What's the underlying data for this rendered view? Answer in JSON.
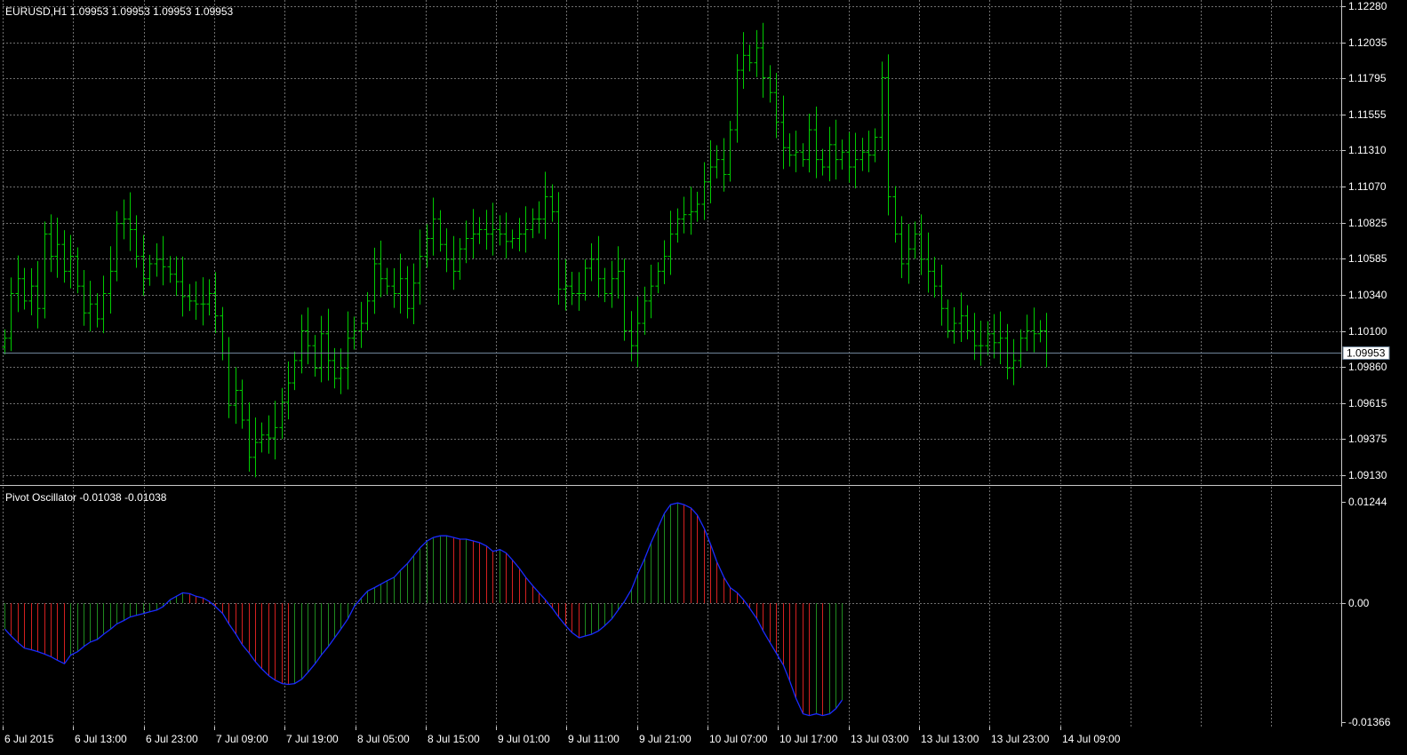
{
  "window": {
    "main_title": "EURUSD,H1  1.09953 1.09953 1.09953 1.09953",
    "indicator_title": "Pivot Oscillator -0.01038 -0.01038",
    "current_price_label": "1.09953"
  },
  "colors": {
    "background": "#000000",
    "grid": "#6f6f6f",
    "axis_text": "#ffffff",
    "bars": "#00cc00",
    "current_price_line": "#6f8499",
    "osc_line": "#1a2bff",
    "osc_up": "#1f8a1f",
    "osc_down": "#d42020"
  },
  "chart_data": [
    {
      "type": "bar",
      "symbol": "EURUSD",
      "timeframe": "H1",
      "title": "EURUSD,H1  1.09953 1.09953 1.09953 1.09953",
      "ylim": [
        1.0913,
        1.1228
      ],
      "y_ticks": [
        "1.12280",
        "1.12035",
        "1.11795",
        "1.11555",
        "1.11310",
        "1.11070",
        "1.10825",
        "1.10585",
        "1.10340",
        "1.10100",
        "1.09860",
        "1.09615",
        "1.09375",
        "1.09130"
      ],
      "current_price": 1.09953,
      "grid": true,
      "x_ticks": [
        "6 Jul 2015",
        "6 Jul 13:00",
        "6 Jul 23:00",
        "7 Jul 09:00",
        "7 Jul 19:00",
        "8 Jul 05:00",
        "8 Jul 15:00",
        "9 Jul 01:00",
        "9 Jul 11:00",
        "9 Jul 21:00",
        "10 Jul 07:00",
        "10 Jul 17:00",
        "13 Jul 03:00",
        "13 Jul 13:00",
        "13 Jul 23:00",
        "14 Jul 09:00"
      ],
      "closes": [
        1.1005,
        1.1035,
        1.1045,
        1.103,
        1.104,
        1.1025,
        1.1075,
        1.106,
        1.1068,
        1.105,
        1.106,
        1.104,
        1.1022,
        1.1028,
        1.1018,
        1.1035,
        1.105,
        1.1082,
        1.1085,
        1.1078,
        1.106,
        1.1045,
        1.1055,
        1.1058,
        1.1053,
        1.1048,
        1.1043,
        1.1033,
        1.103,
        1.1028,
        1.1028,
        1.1035,
        1.102,
        1.0995,
        1.096,
        1.097,
        1.095,
        1.0925,
        1.0935,
        1.094,
        1.0938,
        1.0945,
        1.0962,
        1.0975,
        1.099,
        1.101,
        1.1,
        1.0985,
        1.1008,
        1.099,
        1.0978,
        1.0985,
        1.1005,
        1.101,
        1.1015,
        1.103,
        1.1055,
        1.1045,
        1.104,
        1.1035,
        1.1045,
        1.1025,
        1.1042,
        1.106,
        1.1072,
        1.1085,
        1.1068,
        1.1058,
        1.105,
        1.1065,
        1.1072,
        1.1075,
        1.1078,
        1.1075,
        1.1078,
        1.1075,
        1.107,
        1.1072,
        1.1075,
        1.1078,
        1.1085,
        1.1085,
        1.11,
        1.109,
        1.1038,
        1.104,
        1.1035,
        1.1035,
        1.1052,
        1.1058,
        1.1045,
        1.1035,
        1.1045,
        1.105,
        1.101,
        1.1,
        1.1015,
        1.103,
        1.104,
        1.105,
        1.106,
        1.1075,
        1.1085,
        1.1088,
        1.109,
        1.1095,
        1.111,
        1.112,
        1.1125,
        1.1115,
        1.1145,
        1.1185,
        1.1195,
        1.119,
        1.12,
        1.118,
        1.117,
        1.115,
        1.1133,
        1.1128,
        1.113,
        1.1125,
        1.1145,
        1.1125,
        1.112,
        1.1135,
        1.1125,
        1.113,
        1.112,
        1.1125,
        1.113,
        1.1128,
        1.114,
        1.118,
        1.11,
        1.1075,
        1.1055,
        1.1065,
        1.1075,
        1.1058,
        1.105,
        1.104,
        1.1025,
        1.101,
        1.1015,
        1.102,
        1.101,
        1.1,
        1.1,
        1.1008,
        1.1002,
        1.1005,
        1.0985,
        1.099,
        1.1005,
        1.101,
        1.1008,
        1.101,
        1.0995
      ]
    },
    {
      "type": "bar",
      "title": "Pivot Oscillator -0.01038 -0.01038",
      "ylim": [
        -0.01366,
        0.01244
      ],
      "y_ticks": [
        "0.01244",
        "0.00",
        "-0.01366"
      ],
      "values": [
        -0.003,
        -0.0038,
        -0.0046,
        -0.0052,
        -0.0054,
        -0.0056,
        -0.0059,
        -0.0062,
        -0.0066,
        -0.007,
        -0.006,
        -0.0056,
        -0.005,
        -0.0045,
        -0.0042,
        -0.0036,
        -0.003,
        -0.0024,
        -0.002,
        -0.0016,
        -0.0014,
        -0.0012,
        -0.001,
        -0.0008,
        -0.0004,
        0.0004,
        0.0008,
        0.0012,
        0.0011,
        0.0008,
        0.0006,
        0.0002,
        -0.0004,
        -0.0012,
        -0.0024,
        -0.0036,
        -0.0048,
        -0.0058,
        -0.0068,
        -0.0076,
        -0.0084,
        -0.0089,
        -0.0093,
        -0.0094,
        -0.0093,
        -0.0088,
        -0.008,
        -0.007,
        -0.006,
        -0.005,
        -0.004,
        -0.003,
        -0.0018,
        -0.0004,
        0.0006,
        0.0014,
        0.0018,
        0.0022,
        0.0026,
        0.003,
        0.0038,
        0.0046,
        0.0055,
        0.0064,
        0.0072,
        0.0076,
        0.0078,
        0.0078,
        0.0076,
        0.0074,
        0.0074,
        0.0072,
        0.007,
        0.0066,
        0.006,
        0.0062,
        0.0058,
        0.005,
        0.004,
        0.003,
        0.002,
        0.0012,
        0.0004,
        -0.0006,
        -0.0016,
        -0.0026,
        -0.0034,
        -0.004,
        -0.0038,
        -0.0036,
        -0.0032,
        -0.0026,
        -0.0018,
        -0.0008,
        0.0002,
        0.0016,
        0.0034,
        0.0052,
        0.007,
        0.0088,
        0.0104,
        0.0114,
        0.0116,
        0.0114,
        0.011,
        0.0102,
        0.0086,
        0.0068,
        0.0048,
        0.003,
        0.0018,
        0.0012,
        0.0004,
        -0.0006,
        -0.0018,
        -0.0032,
        -0.0046,
        -0.0058,
        -0.0072,
        -0.009,
        -0.011,
        -0.0128,
        -0.013,
        -0.0128,
        -0.013,
        -0.0128,
        -0.0122,
        -0.0112
      ]
    }
  ]
}
